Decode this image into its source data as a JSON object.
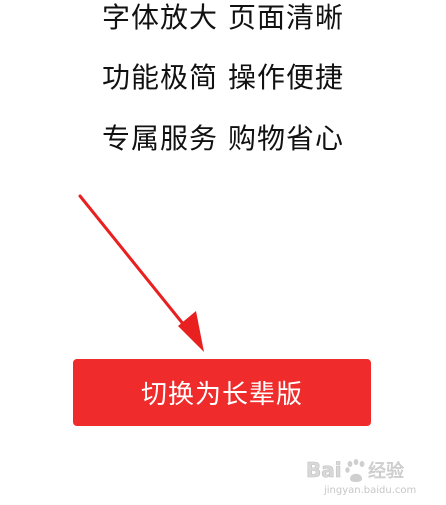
{
  "features": [
    "字体放大 页面清晰",
    "功能极简 操作便捷",
    "专属服务 购物省心"
  ],
  "switch_button": {
    "label": "切换为长辈版"
  },
  "watermark": {
    "logo_text": "Baidu经验",
    "url": "jingyan.baidu.com"
  },
  "colors": {
    "button": "#ef2b2b",
    "arrow": "#e8201f",
    "text": "#111111"
  }
}
